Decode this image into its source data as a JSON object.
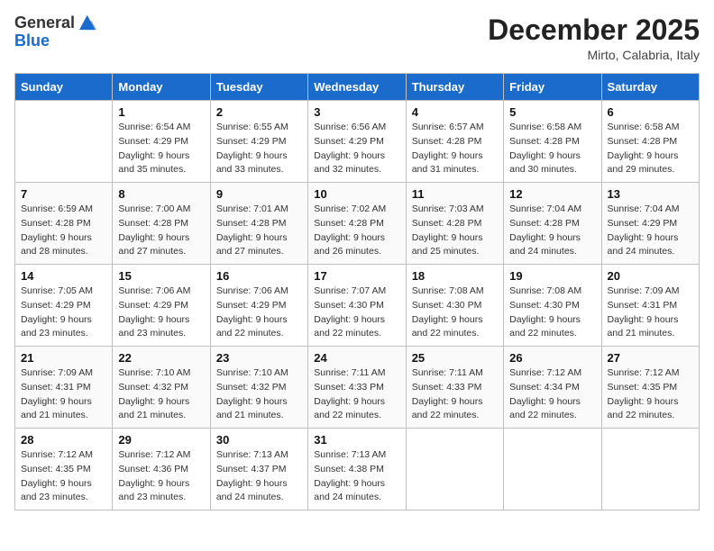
{
  "header": {
    "logo_general": "General",
    "logo_blue": "Blue",
    "month_title": "December 2025",
    "location": "Mirto, Calabria, Italy"
  },
  "days_of_week": [
    "Sunday",
    "Monday",
    "Tuesday",
    "Wednesday",
    "Thursday",
    "Friday",
    "Saturday"
  ],
  "weeks": [
    [
      {
        "day": "",
        "sunrise": "",
        "sunset": "",
        "daylight": ""
      },
      {
        "day": "1",
        "sunrise": "Sunrise: 6:54 AM",
        "sunset": "Sunset: 4:29 PM",
        "daylight": "Daylight: 9 hours and 35 minutes."
      },
      {
        "day": "2",
        "sunrise": "Sunrise: 6:55 AM",
        "sunset": "Sunset: 4:29 PM",
        "daylight": "Daylight: 9 hours and 33 minutes."
      },
      {
        "day": "3",
        "sunrise": "Sunrise: 6:56 AM",
        "sunset": "Sunset: 4:29 PM",
        "daylight": "Daylight: 9 hours and 32 minutes."
      },
      {
        "day": "4",
        "sunrise": "Sunrise: 6:57 AM",
        "sunset": "Sunset: 4:28 PM",
        "daylight": "Daylight: 9 hours and 31 minutes."
      },
      {
        "day": "5",
        "sunrise": "Sunrise: 6:58 AM",
        "sunset": "Sunset: 4:28 PM",
        "daylight": "Daylight: 9 hours and 30 minutes."
      },
      {
        "day": "6",
        "sunrise": "Sunrise: 6:58 AM",
        "sunset": "Sunset: 4:28 PM",
        "daylight": "Daylight: 9 hours and 29 minutes."
      }
    ],
    [
      {
        "day": "7",
        "sunrise": "Sunrise: 6:59 AM",
        "sunset": "Sunset: 4:28 PM",
        "daylight": "Daylight: 9 hours and 28 minutes."
      },
      {
        "day": "8",
        "sunrise": "Sunrise: 7:00 AM",
        "sunset": "Sunset: 4:28 PM",
        "daylight": "Daylight: 9 hours and 27 minutes."
      },
      {
        "day": "9",
        "sunrise": "Sunrise: 7:01 AM",
        "sunset": "Sunset: 4:28 PM",
        "daylight": "Daylight: 9 hours and 27 minutes."
      },
      {
        "day": "10",
        "sunrise": "Sunrise: 7:02 AM",
        "sunset": "Sunset: 4:28 PM",
        "daylight": "Daylight: 9 hours and 26 minutes."
      },
      {
        "day": "11",
        "sunrise": "Sunrise: 7:03 AM",
        "sunset": "Sunset: 4:28 PM",
        "daylight": "Daylight: 9 hours and 25 minutes."
      },
      {
        "day": "12",
        "sunrise": "Sunrise: 7:04 AM",
        "sunset": "Sunset: 4:28 PM",
        "daylight": "Daylight: 9 hours and 24 minutes."
      },
      {
        "day": "13",
        "sunrise": "Sunrise: 7:04 AM",
        "sunset": "Sunset: 4:29 PM",
        "daylight": "Daylight: 9 hours and 24 minutes."
      }
    ],
    [
      {
        "day": "14",
        "sunrise": "Sunrise: 7:05 AM",
        "sunset": "Sunset: 4:29 PM",
        "daylight": "Daylight: 9 hours and 23 minutes."
      },
      {
        "day": "15",
        "sunrise": "Sunrise: 7:06 AM",
        "sunset": "Sunset: 4:29 PM",
        "daylight": "Daylight: 9 hours and 23 minutes."
      },
      {
        "day": "16",
        "sunrise": "Sunrise: 7:06 AM",
        "sunset": "Sunset: 4:29 PM",
        "daylight": "Daylight: 9 hours and 22 minutes."
      },
      {
        "day": "17",
        "sunrise": "Sunrise: 7:07 AM",
        "sunset": "Sunset: 4:30 PM",
        "daylight": "Daylight: 9 hours and 22 minutes."
      },
      {
        "day": "18",
        "sunrise": "Sunrise: 7:08 AM",
        "sunset": "Sunset: 4:30 PM",
        "daylight": "Daylight: 9 hours and 22 minutes."
      },
      {
        "day": "19",
        "sunrise": "Sunrise: 7:08 AM",
        "sunset": "Sunset: 4:30 PM",
        "daylight": "Daylight: 9 hours and 22 minutes."
      },
      {
        "day": "20",
        "sunrise": "Sunrise: 7:09 AM",
        "sunset": "Sunset: 4:31 PM",
        "daylight": "Daylight: 9 hours and 21 minutes."
      }
    ],
    [
      {
        "day": "21",
        "sunrise": "Sunrise: 7:09 AM",
        "sunset": "Sunset: 4:31 PM",
        "daylight": "Daylight: 9 hours and 21 minutes."
      },
      {
        "day": "22",
        "sunrise": "Sunrise: 7:10 AM",
        "sunset": "Sunset: 4:32 PM",
        "daylight": "Daylight: 9 hours and 21 minutes."
      },
      {
        "day": "23",
        "sunrise": "Sunrise: 7:10 AM",
        "sunset": "Sunset: 4:32 PM",
        "daylight": "Daylight: 9 hours and 21 minutes."
      },
      {
        "day": "24",
        "sunrise": "Sunrise: 7:11 AM",
        "sunset": "Sunset: 4:33 PM",
        "daylight": "Daylight: 9 hours and 22 minutes."
      },
      {
        "day": "25",
        "sunrise": "Sunrise: 7:11 AM",
        "sunset": "Sunset: 4:33 PM",
        "daylight": "Daylight: 9 hours and 22 minutes."
      },
      {
        "day": "26",
        "sunrise": "Sunrise: 7:12 AM",
        "sunset": "Sunset: 4:34 PM",
        "daylight": "Daylight: 9 hours and 22 minutes."
      },
      {
        "day": "27",
        "sunrise": "Sunrise: 7:12 AM",
        "sunset": "Sunset: 4:35 PM",
        "daylight": "Daylight: 9 hours and 22 minutes."
      }
    ],
    [
      {
        "day": "28",
        "sunrise": "Sunrise: 7:12 AM",
        "sunset": "Sunset: 4:35 PM",
        "daylight": "Daylight: 9 hours and 23 minutes."
      },
      {
        "day": "29",
        "sunrise": "Sunrise: 7:12 AM",
        "sunset": "Sunset: 4:36 PM",
        "daylight": "Daylight: 9 hours and 23 minutes."
      },
      {
        "day": "30",
        "sunrise": "Sunrise: 7:13 AM",
        "sunset": "Sunset: 4:37 PM",
        "daylight": "Daylight: 9 hours and 24 minutes."
      },
      {
        "day": "31",
        "sunrise": "Sunrise: 7:13 AM",
        "sunset": "Sunset: 4:38 PM",
        "daylight": "Daylight: 9 hours and 24 minutes."
      },
      {
        "day": "",
        "sunrise": "",
        "sunset": "",
        "daylight": ""
      },
      {
        "day": "",
        "sunrise": "",
        "sunset": "",
        "daylight": ""
      },
      {
        "day": "",
        "sunrise": "",
        "sunset": "",
        "daylight": ""
      }
    ]
  ]
}
